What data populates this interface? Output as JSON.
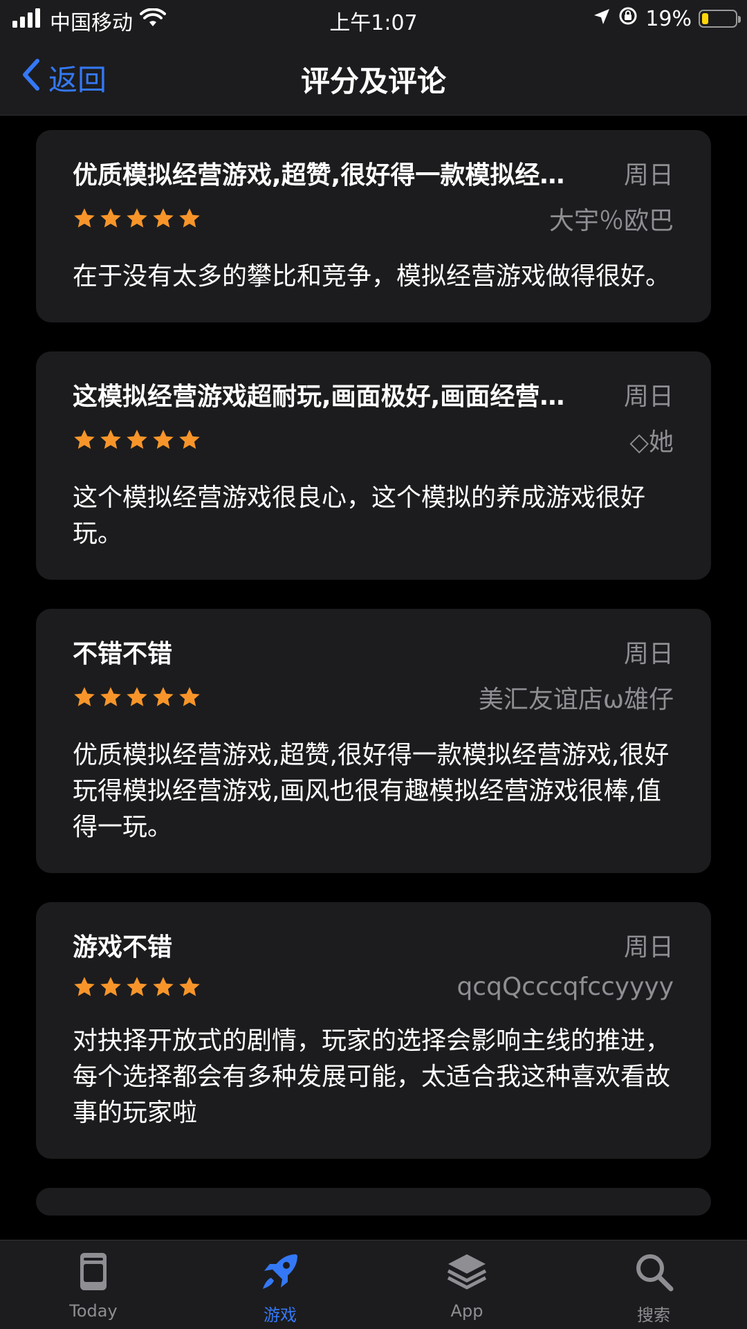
{
  "status": {
    "carrier": "中国移动",
    "time": "上午1:07",
    "battery_percent": "19%",
    "battery_level": 0.19
  },
  "nav": {
    "back_label": "返回",
    "title": "评分及评论"
  },
  "reviews": [
    {
      "title": "优质模拟经营游戏,超赞,很好得一款模拟经营游戏,很好玩得模拟经营游戏",
      "date": "周日",
      "author": "大宇％欧巴",
      "rating": 5,
      "body": "在于没有太多的攀比和竞争，模拟经营游戏做得很好。"
    },
    {
      "title": "这模拟经营游戏超耐玩,画面极好,画面经营游戏超赞",
      "date": "周日",
      "author": "◇她",
      "rating": 5,
      "body": "这个模拟经营游戏很良心，这个模拟的养成游戏很好玩。"
    },
    {
      "title": "不错不错",
      "date": "周日",
      "author": "美汇友谊店ω雄仔",
      "rating": 5,
      "body": "优质模拟经营游戏,超赞,很好得一款模拟经营游戏,很好玩得模拟经营游戏,画风也很有趣模拟经营游戏很棒,值得一玩。"
    },
    {
      "title": "游戏不错",
      "date": "周日",
      "author": "qcqQcccqfccyyyy",
      "rating": 5,
      "body": "对抉择开放式的剧情，玩家的选择会影响主线的推进，每个选择都会有多种发展可能，太适合我这种喜欢看故事的玩家啦"
    }
  ],
  "tabs": [
    {
      "label": "Today",
      "icon": "today-icon"
    },
    {
      "label": "游戏",
      "icon": "rocket-icon",
      "active": true
    },
    {
      "label": "App",
      "icon": "apps-stack-icon"
    },
    {
      "label": "搜索",
      "icon": "search-icon"
    }
  ],
  "colors": {
    "accent": "#3478f6",
    "star": "#f7952a",
    "card": "#1c1c1e",
    "secondary_text": "#8e8e93"
  }
}
